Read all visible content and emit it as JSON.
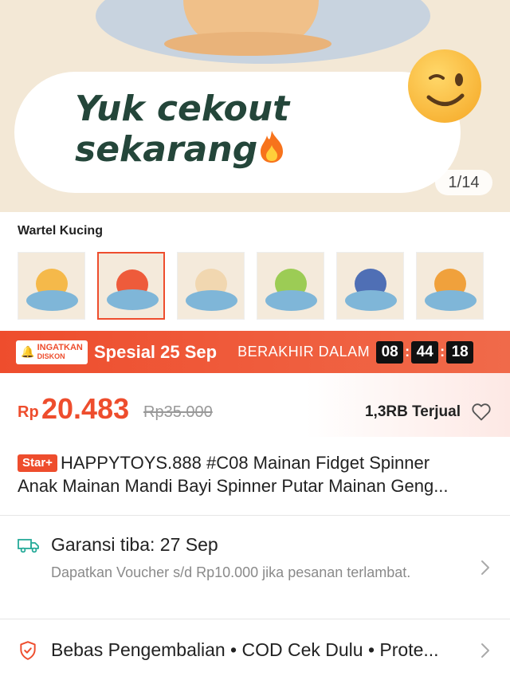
{
  "hero": {
    "banner_text_line1": "Yuk cekout",
    "banner_text_line2": "sekarang",
    "emoji": "fire-emoji",
    "wink_emoji": "wink-emoji",
    "image_counter": "1/14"
  },
  "variants": {
    "label": "Wartel Kucing",
    "items": [
      {
        "name": "variant-1",
        "top_color": "#f5b94a",
        "selected": false
      },
      {
        "name": "variant-2",
        "top_color": "#ee5b3b",
        "selected": true
      },
      {
        "name": "variant-3",
        "top_color": "#f1d7b0",
        "selected": false
      },
      {
        "name": "variant-4",
        "top_color": "#9ccc55",
        "selected": false
      },
      {
        "name": "variant-5",
        "top_color": "#4f6fb5",
        "selected": false
      },
      {
        "name": "variant-6",
        "top_color": "#f0a13c",
        "selected": false
      }
    ]
  },
  "promo": {
    "badge_line1": "INGATKAN",
    "badge_line2": "DISKON",
    "title": "Spesial 25 Sep",
    "ends_label": "BERAKHIR DALAM",
    "hours": "08",
    "minutes": "44",
    "seconds": "18"
  },
  "price": {
    "currency": "Rp",
    "current": "20.483",
    "original": "Rp35.000",
    "sold": "1,3RB Terjual"
  },
  "product": {
    "badge": "Star+",
    "title_line1": "HAPPYTOYS.888 #C08 Mainan Fidget Spinner",
    "title_line2": "Anak Mainan Mandi Bayi Spinner Putar Mainan Geng..."
  },
  "shipping": {
    "title": "Garansi tiba: 27 Sep",
    "subtitle": "Dapatkan Voucher s/d Rp10.000 jika pesanan terlambat."
  },
  "returns": {
    "text": "Bebas Pengembalian • COD Cek Dulu • Prote..."
  },
  "colors": {
    "accent": "#ee4d2d",
    "shipping_green": "#26aa99"
  }
}
